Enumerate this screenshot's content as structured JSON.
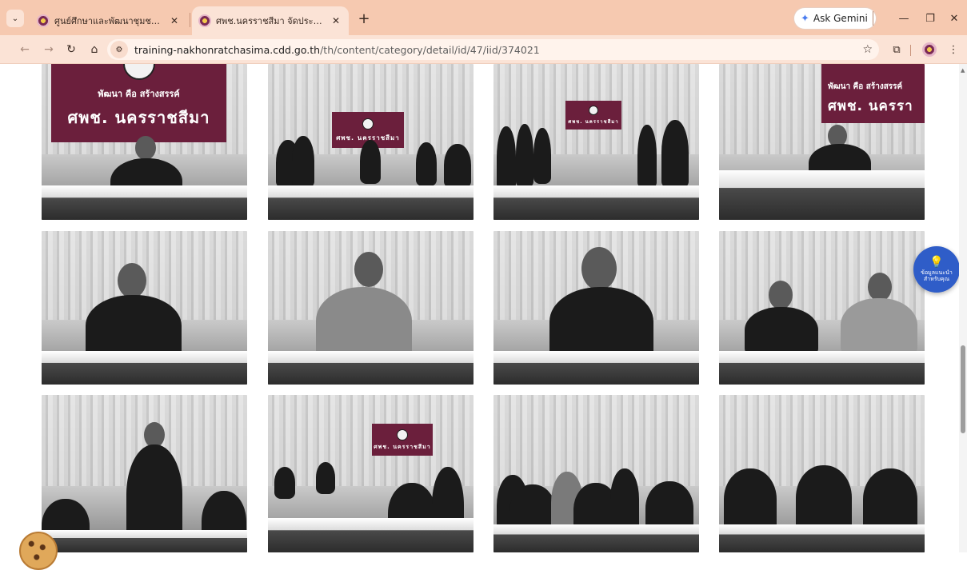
{
  "browser": {
    "tabs": [
      {
        "title": "ศูนย์ศึกษาและพัฒนาชุมชนนครราชสี",
        "active": false
      },
      {
        "title": "ศพช.นครราชสีมา จัดประชุมเจ้าหน้าที่",
        "active": true
      }
    ],
    "tab_close_glyph": "✕",
    "new_tab_glyph": "+",
    "tab_search_glyph": "⌄",
    "gemini_label": "Ask Gemini",
    "gemini_icon": "✦",
    "window_controls": {
      "minimize": "—",
      "maximize": "❐",
      "close": "✕"
    },
    "nav": {
      "back": "←",
      "forward": "→",
      "reload": "↻",
      "home": "⌂"
    },
    "site_info_glyph": "⚙",
    "url_host": "training-nakhonratchasima.cdd.go.th",
    "url_path": "/th/content/category/detail/id/47/iid/374021",
    "bookmark_glyph": "☆",
    "extensions_glyph": "⧉",
    "menu_glyph": "⋮"
  },
  "gallery": {
    "photos": [
      {
        "name": "photo-1",
        "banner_arc": "พัฒนา คือ สร้างสรรค์",
        "banner_text": "ศพช. นครราชสีมา"
      },
      {
        "name": "photo-2",
        "banner_arc": "",
        "banner_text": "ศพช. นครราชสีมา"
      },
      {
        "name": "photo-3",
        "banner_arc": "",
        "banner_text": "ศพช. นครราชสีมา"
      },
      {
        "name": "photo-4",
        "banner_arc": "พัฒนา คือ สร้างสรรค์",
        "banner_text": "ศพช. นครรา"
      },
      {
        "name": "photo-5"
      },
      {
        "name": "photo-6"
      },
      {
        "name": "photo-7"
      },
      {
        "name": "photo-8"
      },
      {
        "name": "photo-9"
      },
      {
        "name": "photo-10",
        "banner_text": "ศพช. นครราชสีมา"
      },
      {
        "name": "photo-11"
      },
      {
        "name": "photo-12"
      }
    ]
  },
  "help_button": {
    "icon": "💡",
    "label_line1": "ข้อมูลแนะนำ",
    "label_line2": "สำหรับคุณ"
  },
  "colors": {
    "tabbar": "#f6c9b0",
    "toolbar": "#fbe3d6",
    "banner": "#6b1f3c",
    "help": "#2f5dc8"
  }
}
